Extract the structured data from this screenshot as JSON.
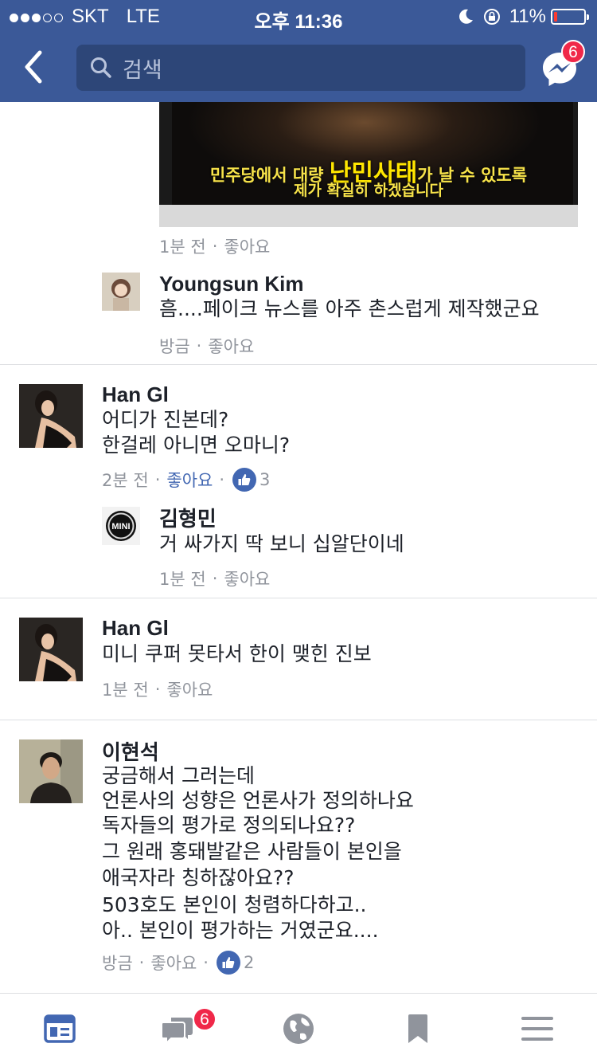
{
  "status_bar": {
    "carrier": "SKT",
    "network": "LTE",
    "time": "오후 11:36",
    "battery": "11%",
    "battery_level": 0.11
  },
  "nav": {
    "search_placeholder": "검색",
    "messenger_badge": "6"
  },
  "post_image": {
    "caption_pre": "민주당에서 대량 ",
    "caption_highlight": "난민사태",
    "caption_post": "가 날 수 있도록",
    "caption_line2": "제가 확실히 하겠습니다"
  },
  "comments": [
    {
      "meta_time": "1분 전",
      "meta_like": "좋아요"
    },
    {
      "name": "Youngsun Kim",
      "text": "흠....페이크 뉴스를 아주 촌스럽게 제작했군요",
      "meta_time": "방금",
      "meta_like": "좋아요"
    },
    {
      "name": "Han Gl",
      "line1": "어디가 진본데?",
      "line2": "한걸레 아니면 오마니?",
      "meta_time": "2분 전",
      "meta_like": "좋아요",
      "like_count": "3"
    },
    {
      "name": "김형민",
      "avatar_label": "MINI",
      "text": "거 싸가지 딱 보니 십알단이네",
      "meta_time": "1분 전",
      "meta_like": "좋아요"
    },
    {
      "name": "Han Gl",
      "text": "미니 쿠퍼 못타서 한이 맺힌 진보",
      "meta_time": "1분 전",
      "meta_like": "좋아요"
    },
    {
      "name": "이현석",
      "lines": [
        "궁금해서 그러는데",
        "언론사의 성향은 언론사가 정의하나요",
        "독자들의 평가로 정의되나요??",
        "그 원래 홍돼발같은 사람들이 본인을",
        "애국자라 칭하잖아요??",
        "503호도 본인이 청렴하다하고..",
        "아.. 본인이 평가하는 거였군요...."
      ],
      "meta_time": "방금",
      "meta_like": "좋아요",
      "like_count": "2"
    }
  ],
  "tab_bar": {
    "notifications_badge": "6"
  },
  "colors": {
    "brand": "#3b5998",
    "link": "#4267b2",
    "badge": "#f02849",
    "meta": "#90949c"
  }
}
